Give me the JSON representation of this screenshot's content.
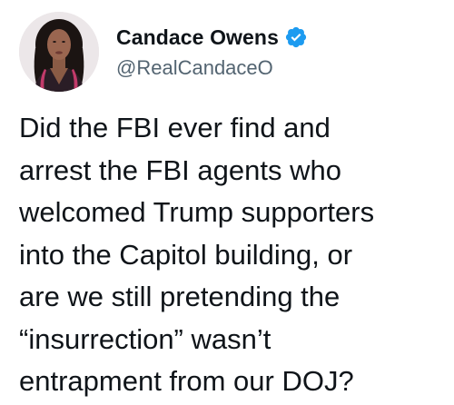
{
  "author": {
    "display_name": "Candace Owens",
    "handle": "@RealCandaceO",
    "verified": true,
    "avatar_icon": "profile-photo",
    "verified_icon": "verified-badge-icon",
    "verified_color": "#1d9bf0"
  },
  "tweet": {
    "lines": [
      "Did the FBI ever find and",
      "arrest the FBI agents who",
      "welcomed Trump supporters",
      "into the Capitol building, or",
      "are we still pretending the",
      "“insurrection” wasn’t",
      "entrapment from our DOJ?"
    ]
  },
  "colors": {
    "text_primary": "#0f1419",
    "text_secondary": "#536471",
    "background": "#ffffff"
  }
}
